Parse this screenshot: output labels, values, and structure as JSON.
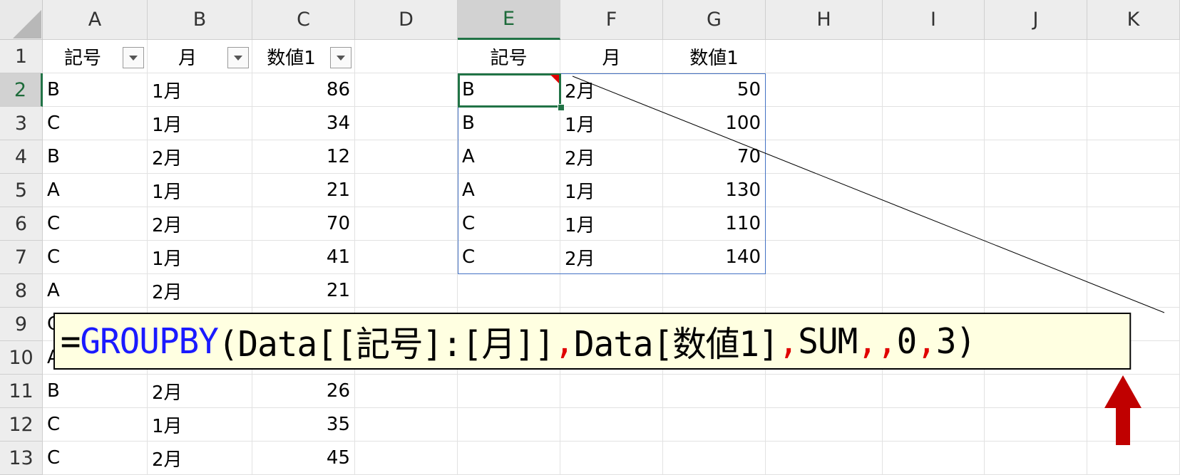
{
  "columns": [
    "A",
    "B",
    "C",
    "D",
    "E",
    "F",
    "G",
    "H",
    "I",
    "J",
    "K"
  ],
  "active_column": "E",
  "rows": [
    "1",
    "2",
    "3",
    "4",
    "5",
    "6",
    "7",
    "8",
    "9",
    "10",
    "11",
    "12",
    "13"
  ],
  "active_row": "2",
  "source_table": {
    "headers": [
      "記号",
      "月",
      "数値1"
    ],
    "rows": [
      [
        "B",
        "1月",
        "86"
      ],
      [
        "C",
        "1月",
        "34"
      ],
      [
        "B",
        "2月",
        "12"
      ],
      [
        "A",
        "1月",
        "21"
      ],
      [
        "C",
        "2月",
        "70"
      ],
      [
        "C",
        "1月",
        "41"
      ],
      [
        "A",
        "2月",
        "21"
      ],
      [
        "C",
        "",
        ""
      ],
      [
        "A",
        "",
        ""
      ],
      [
        "B",
        "2月",
        "26"
      ],
      [
        "C",
        "1月",
        "35"
      ],
      [
        "C",
        "2月",
        "45"
      ]
    ]
  },
  "result_table": {
    "headers": [
      "記号",
      "月",
      "数値1"
    ],
    "rows": [
      [
        "B",
        "2月",
        "50"
      ],
      [
        "B",
        "1月",
        "100"
      ],
      [
        "A",
        "2月",
        "70"
      ],
      [
        "A",
        "1月",
        "130"
      ],
      [
        "C",
        "1月",
        "110"
      ],
      [
        "C",
        "2月",
        "140"
      ]
    ]
  },
  "formula": {
    "parts": [
      {
        "text": "=",
        "color": "#000000"
      },
      {
        "text": "GROUPBY",
        "color": "#1a1aff"
      },
      {
        "text": "(Data[[記号]:[月]]",
        "color": "#000000"
      },
      {
        "text": ",",
        "color": "#e00000"
      },
      {
        "text": "Data[数値1]",
        "color": "#000000"
      },
      {
        "text": ",",
        "color": "#e00000"
      },
      {
        "text": "SUM",
        "color": "#000000"
      },
      {
        "text": ",",
        "color": "#e00000"
      },
      {
        "text": ",",
        "color": "#e00000"
      },
      {
        "text": "0",
        "color": "#000000"
      },
      {
        "text": ",",
        "color": "#e00000"
      },
      {
        "text": "3)",
        "color": "#000000"
      }
    ]
  },
  "colors": {
    "active_green": "#217346",
    "spill_blue": "#4472c4",
    "arrow_red": "#c00000",
    "formula_bg": "#ffffe1"
  },
  "icons": [
    "filter-dropdown-icon",
    "up-arrow-icon",
    "comment-indicator-icon"
  ]
}
